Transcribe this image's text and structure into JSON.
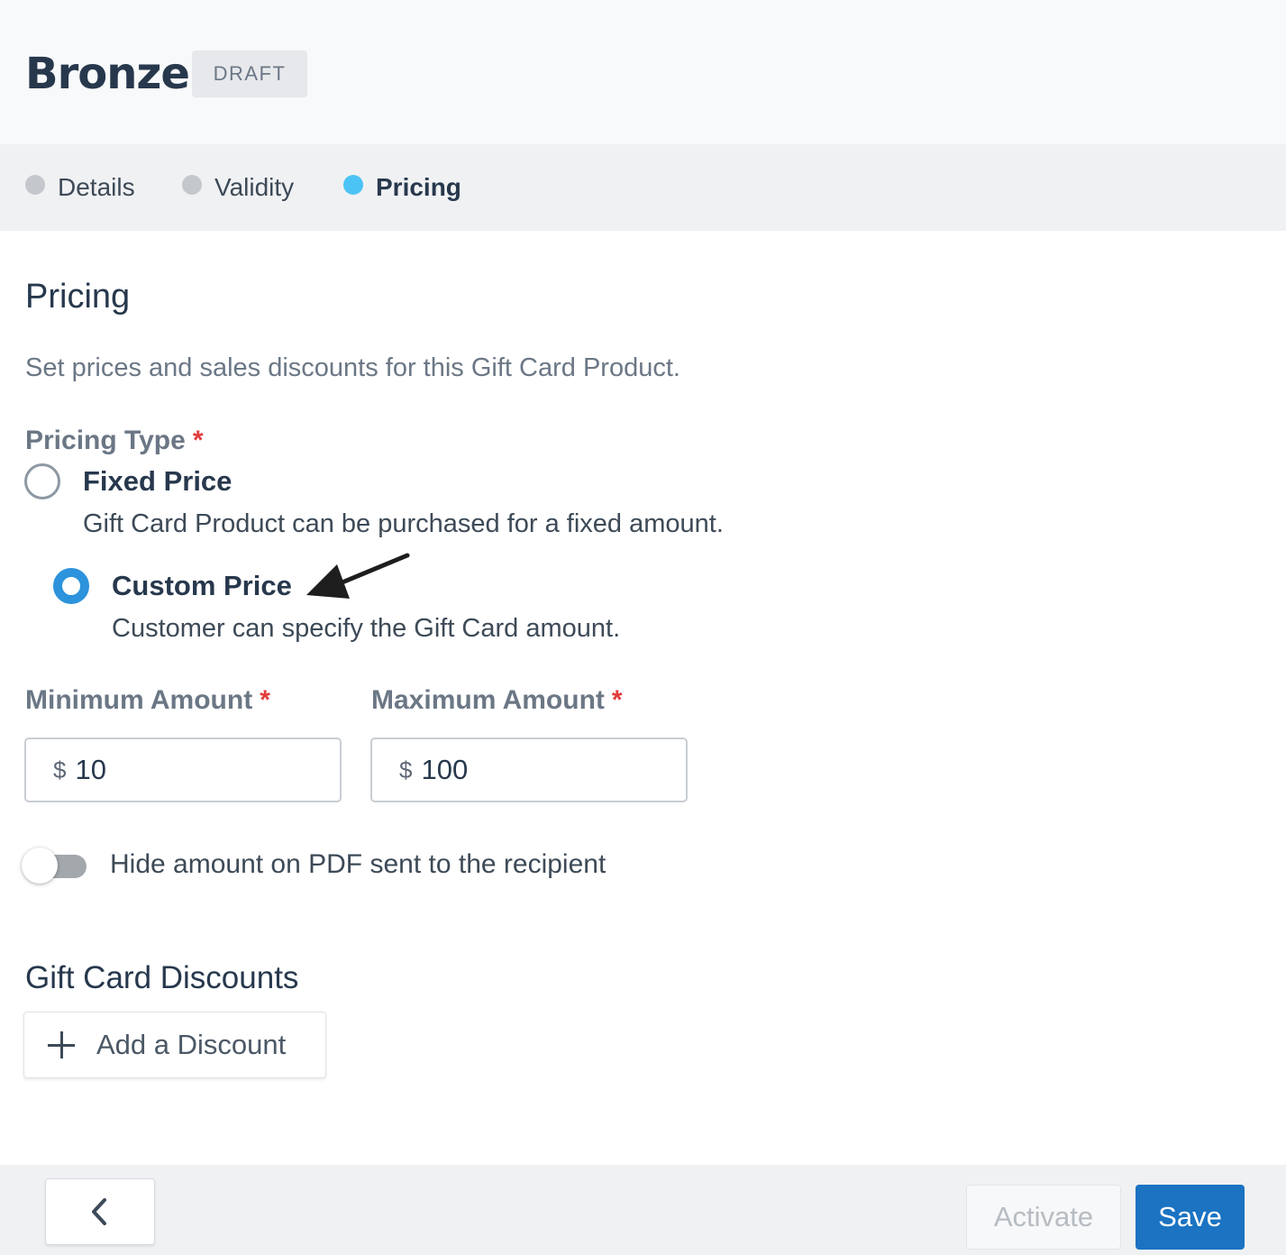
{
  "header": {
    "title": "Bronze",
    "status_badge": "DRAFT"
  },
  "steps": [
    {
      "label": "Details",
      "active": false
    },
    {
      "label": "Validity",
      "active": false
    },
    {
      "label": "Pricing",
      "active": true
    }
  ],
  "pricing": {
    "title": "Pricing",
    "description": "Set prices and sales discounts for this Gift Card Product.",
    "pricing_type_label": "Pricing Type",
    "required_marker": "*",
    "options": [
      {
        "title": "Fixed Price",
        "description": "Gift Card Product can be purchased for a fixed amount.",
        "selected": false
      },
      {
        "title": "Custom Price",
        "description": "Customer can specify the Gift Card amount.",
        "selected": true
      }
    ],
    "minimum_amount": {
      "label": "Minimum Amount",
      "currency": "$",
      "value": "10"
    },
    "maximum_amount": {
      "label": "Maximum Amount",
      "currency": "$",
      "value": "100"
    },
    "hide_amount_toggle": {
      "label": "Hide amount on PDF sent to the recipient",
      "on": false
    }
  },
  "discounts": {
    "title": "Gift Card Discounts",
    "add_button_label": "Add a Discount"
  },
  "footer": {
    "back_icon": "chevron-left-icon",
    "activate_label": "Activate",
    "save_label": "Save"
  },
  "colors": {
    "accent": "#2c93dc",
    "active_step": "#4cc3f5",
    "primary_button": "#1b73c2",
    "required": "#e23b3b"
  }
}
